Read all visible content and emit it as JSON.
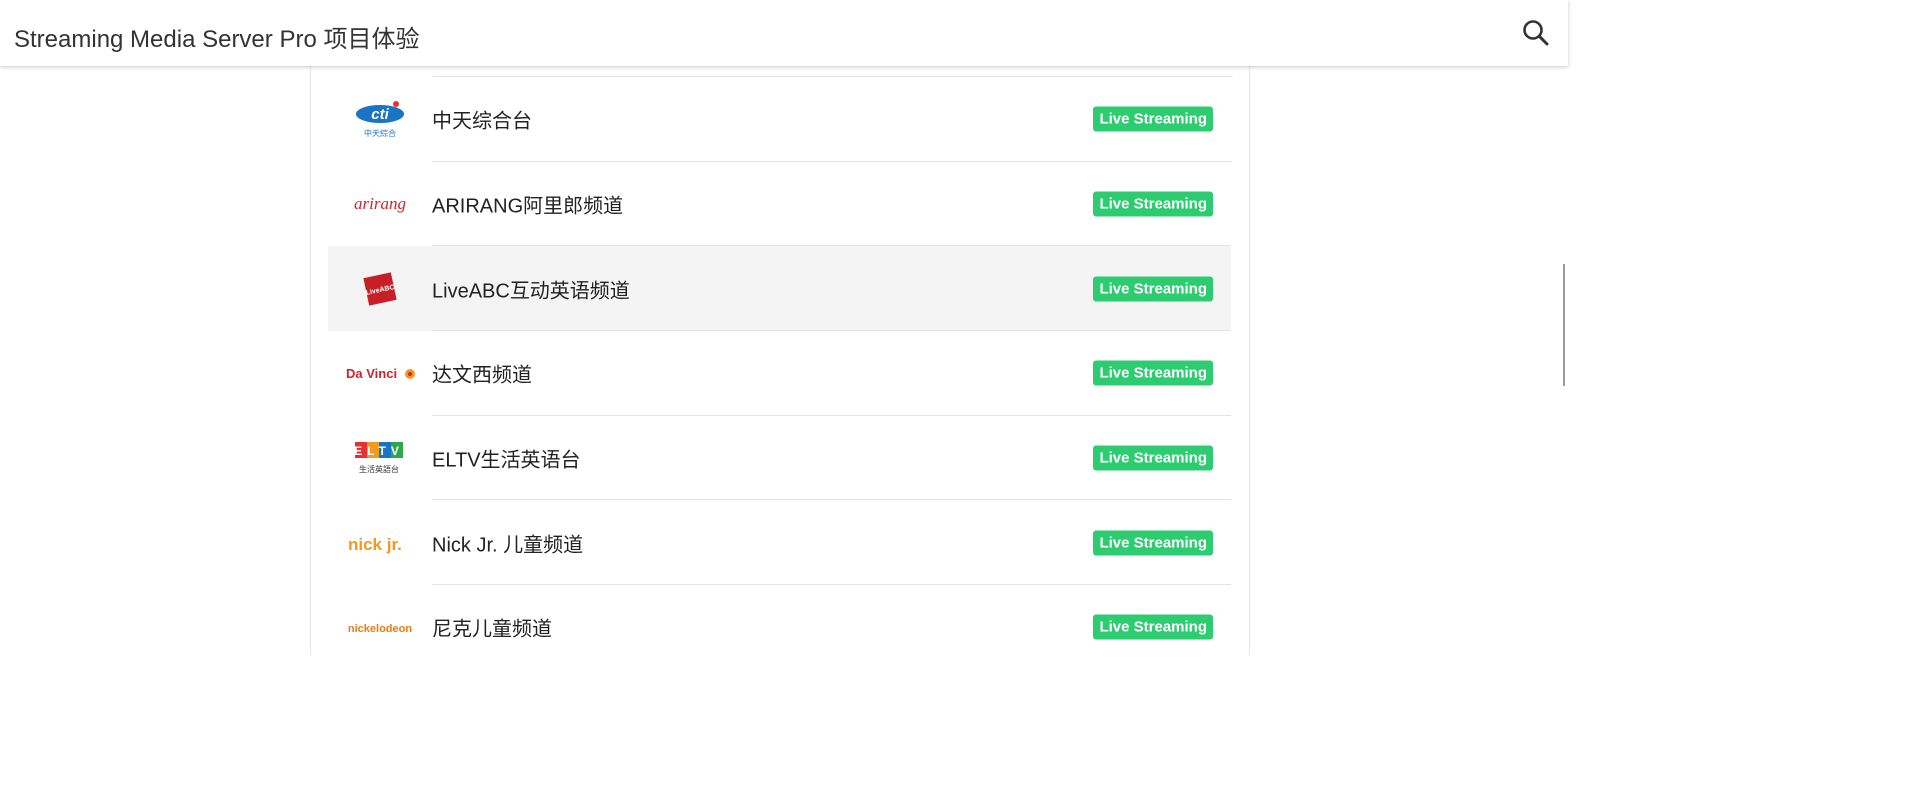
{
  "header": {
    "title": "Streaming Media Server Pro 项目体验",
    "search_icon": "search-icon"
  },
  "channels": [
    {
      "name": "中天综合台",
      "status": "Live Streaming",
      "logo_icon": "cti-logo",
      "logo_text": "cti",
      "logo_subtext": "中天綜合",
      "highlighted": false
    },
    {
      "name": "ARIRANG阿里郎频道",
      "status": "Live Streaming",
      "logo_icon": "arirang-logo",
      "logo_text": "arirang",
      "highlighted": false
    },
    {
      "name": "LiveABC互动英语频道",
      "status": "Live Streaming",
      "logo_icon": "liveabc-logo",
      "logo_text": "LiveABC",
      "highlighted": true
    },
    {
      "name": "达文西频道",
      "status": "Live Streaming",
      "logo_icon": "davinci-logo",
      "logo_text": "Da Vinci",
      "highlighted": false
    },
    {
      "name": "ELTV生活英语台",
      "status": "Live Streaming",
      "logo_icon": "eltv-logo",
      "logo_text": "ELTV",
      "logo_subtext": "生活英語台",
      "highlighted": false
    },
    {
      "name": "Nick Jr. 儿童频道",
      "status": "Live Streaming",
      "logo_icon": "nickjr-logo",
      "logo_text": "nick jr.",
      "highlighted": false
    },
    {
      "name": "尼克儿童频道",
      "status": "Live Streaming",
      "logo_icon": "nickelodeon-logo",
      "logo_text": "nickelodeon",
      "highlighted": false
    }
  ],
  "colors": {
    "badge": "#2ecc71",
    "highlight_row": "#f4f4f4",
    "title_text": "#333333"
  }
}
